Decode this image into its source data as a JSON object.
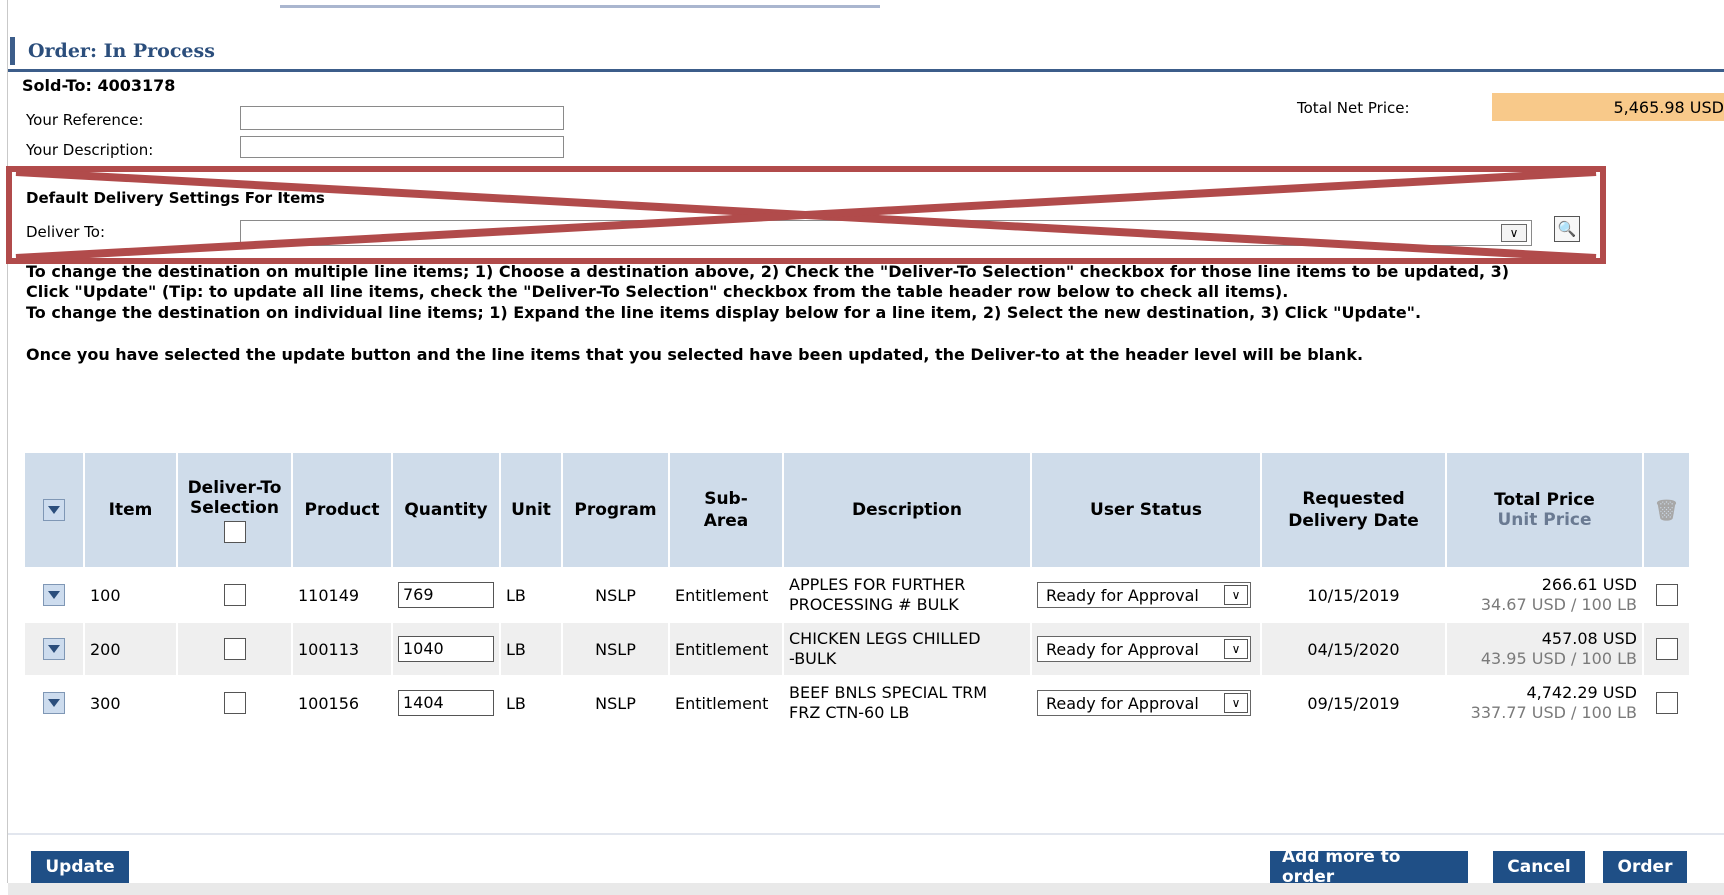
{
  "page": {
    "title": "Order: In Process",
    "sold_to": "Sold-To: 4003178",
    "your_reference_label": "Your Reference:",
    "your_description_label": "Your Description:",
    "your_reference_value": "",
    "your_description_value": "",
    "total_net_price_label": "Total Net Price:",
    "total_net_price_value": "5,465.98 USD"
  },
  "delivery": {
    "section_title": "Default Delivery Settings For Items",
    "deliver_to_label": "Deliver To:",
    "deliver_to_value": ""
  },
  "instructions": {
    "line1": "To change the destination on multiple line items; 1) Choose a destination above, 2) Check the \"Deliver-To Selection\" checkbox for those line items to be updated, 3)",
    "line2": "Click \"Update\" (Tip: to update all line items, check the \"Deliver-To Selection\" checkbox from the table header row below to check all items).",
    "line3": "To change the destination on individual line items; 1) Expand the line items display below for a line item, 2) Select the new destination, 3) Click \"Update\".",
    "line4": "Once you have selected the update button and the line items that you selected have been updated, the Deliver-to at the header level will be blank."
  },
  "table": {
    "headers": {
      "item": "Item",
      "deliver_to_selection": "Deliver-To Selection",
      "product": "Product",
      "quantity": "Quantity",
      "unit": "Unit",
      "program": "Program",
      "sub_area": "Sub-Area",
      "description": "Description",
      "user_status": "User Status",
      "requested_delivery_date": "Requested Delivery Date",
      "total_price": "Total Price",
      "unit_price": "Unit Price"
    },
    "rows": [
      {
        "item": "100",
        "product": "110149",
        "quantity": "769",
        "unit": "LB",
        "program": "NSLP",
        "sub_area": "Entitlement",
        "desc1": "APPLES FOR FURTHER",
        "desc2": "PROCESSING # BULK",
        "status": "Ready for Approval",
        "date": "10/15/2019",
        "total": "266.61 USD",
        "unit_price": "34.67 USD / 100 LB"
      },
      {
        "item": "200",
        "product": "100113",
        "quantity": "1040",
        "unit": "LB",
        "program": "NSLP",
        "sub_area": "Entitlement",
        "desc1": "CHICKEN LEGS CHILLED",
        "desc2": "-BULK",
        "status": "Ready for Approval",
        "date": "04/15/2020",
        "total": "457.08 USD",
        "unit_price": "43.95 USD / 100 LB"
      },
      {
        "item": "300",
        "product": "100156",
        "quantity": "1404",
        "unit": "LB",
        "program": "NSLP",
        "sub_area": "Entitlement",
        "desc1": "BEEF BNLS SPECIAL TRM",
        "desc2": "FRZ CTN-60 LB",
        "status": "Ready for Approval",
        "date": "09/15/2019",
        "total": "4,742.29 USD",
        "unit_price": "337.77 USD / 100 LB"
      }
    ]
  },
  "buttons": {
    "update": "Update",
    "add_more": "Add more to order",
    "cancel": "Cancel",
    "order": "Order"
  },
  "colors": {
    "header_blue": "#2b4e7c",
    "button_blue": "#1f4f86",
    "table_header_bg": "#cfdcea",
    "net_price_bg": "#f8c98a",
    "annotation_red": "#b14b4b"
  }
}
